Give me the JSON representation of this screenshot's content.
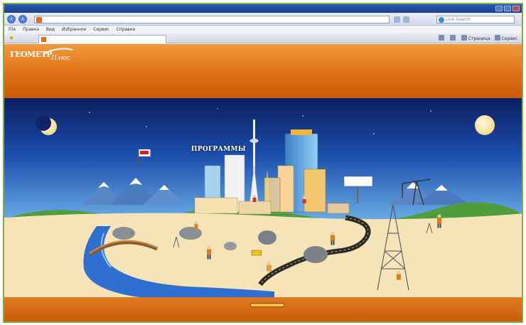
{
  "browser": {
    "title": "",
    "url": "",
    "search_placeholder": "Live Search",
    "menu": [
      "File",
      "Правка",
      "Вид",
      "Избранное",
      "Сервис",
      "Справка"
    ],
    "tab_title": "",
    "tools": [
      "Страница",
      "Сервис"
    ]
  },
  "site": {
    "logo_main": "ГЕОМЕТР",
    "logo_script": "Плюс",
    "nav": [
      "",
      "",
      "",
      "",
      "",
      ""
    ],
    "intro_phone": "",
    "intro_text": "",
    "slogan": ""
  },
  "scene": {
    "label": "ПРОГРАММЫ"
  },
  "footer": {
    "left_highlight": "",
    "left_text": "",
    "center_text": "",
    "right_text": ""
  },
  "colors": {
    "header_orange": "#df6f16",
    "sky_top": "#0b1f5e",
    "sky_bottom": "#6fb4e8",
    "sand": "#f4e4b8",
    "river": "#2f6fd0"
  }
}
